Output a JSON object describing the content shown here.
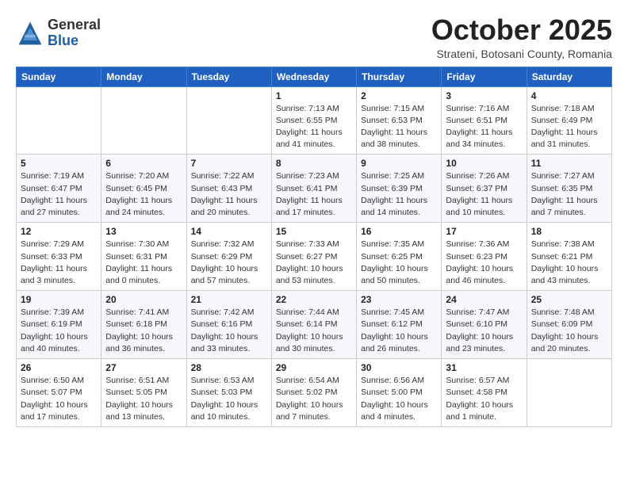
{
  "logo": {
    "general": "General",
    "blue": "Blue"
  },
  "header": {
    "month": "October 2025",
    "location": "Strateni, Botosani County, Romania"
  },
  "days_of_week": [
    "Sunday",
    "Monday",
    "Tuesday",
    "Wednesday",
    "Thursday",
    "Friday",
    "Saturday"
  ],
  "weeks": [
    [
      {
        "day": "",
        "info": ""
      },
      {
        "day": "",
        "info": ""
      },
      {
        "day": "",
        "info": ""
      },
      {
        "day": "1",
        "info": "Sunrise: 7:13 AM\nSunset: 6:55 PM\nDaylight: 11 hours\nand 41 minutes."
      },
      {
        "day": "2",
        "info": "Sunrise: 7:15 AM\nSunset: 6:53 PM\nDaylight: 11 hours\nand 38 minutes."
      },
      {
        "day": "3",
        "info": "Sunrise: 7:16 AM\nSunset: 6:51 PM\nDaylight: 11 hours\nand 34 minutes."
      },
      {
        "day": "4",
        "info": "Sunrise: 7:18 AM\nSunset: 6:49 PM\nDaylight: 11 hours\nand 31 minutes."
      }
    ],
    [
      {
        "day": "5",
        "info": "Sunrise: 7:19 AM\nSunset: 6:47 PM\nDaylight: 11 hours\nand 27 minutes."
      },
      {
        "day": "6",
        "info": "Sunrise: 7:20 AM\nSunset: 6:45 PM\nDaylight: 11 hours\nand 24 minutes."
      },
      {
        "day": "7",
        "info": "Sunrise: 7:22 AM\nSunset: 6:43 PM\nDaylight: 11 hours\nand 20 minutes."
      },
      {
        "day": "8",
        "info": "Sunrise: 7:23 AM\nSunset: 6:41 PM\nDaylight: 11 hours\nand 17 minutes."
      },
      {
        "day": "9",
        "info": "Sunrise: 7:25 AM\nSunset: 6:39 PM\nDaylight: 11 hours\nand 14 minutes."
      },
      {
        "day": "10",
        "info": "Sunrise: 7:26 AM\nSunset: 6:37 PM\nDaylight: 11 hours\nand 10 minutes."
      },
      {
        "day": "11",
        "info": "Sunrise: 7:27 AM\nSunset: 6:35 PM\nDaylight: 11 hours\nand 7 minutes."
      }
    ],
    [
      {
        "day": "12",
        "info": "Sunrise: 7:29 AM\nSunset: 6:33 PM\nDaylight: 11 hours\nand 3 minutes."
      },
      {
        "day": "13",
        "info": "Sunrise: 7:30 AM\nSunset: 6:31 PM\nDaylight: 11 hours\nand 0 minutes."
      },
      {
        "day": "14",
        "info": "Sunrise: 7:32 AM\nSunset: 6:29 PM\nDaylight: 10 hours\nand 57 minutes."
      },
      {
        "day": "15",
        "info": "Sunrise: 7:33 AM\nSunset: 6:27 PM\nDaylight: 10 hours\nand 53 minutes."
      },
      {
        "day": "16",
        "info": "Sunrise: 7:35 AM\nSunset: 6:25 PM\nDaylight: 10 hours\nand 50 minutes."
      },
      {
        "day": "17",
        "info": "Sunrise: 7:36 AM\nSunset: 6:23 PM\nDaylight: 10 hours\nand 46 minutes."
      },
      {
        "day": "18",
        "info": "Sunrise: 7:38 AM\nSunset: 6:21 PM\nDaylight: 10 hours\nand 43 minutes."
      }
    ],
    [
      {
        "day": "19",
        "info": "Sunrise: 7:39 AM\nSunset: 6:19 PM\nDaylight: 10 hours\nand 40 minutes."
      },
      {
        "day": "20",
        "info": "Sunrise: 7:41 AM\nSunset: 6:18 PM\nDaylight: 10 hours\nand 36 minutes."
      },
      {
        "day": "21",
        "info": "Sunrise: 7:42 AM\nSunset: 6:16 PM\nDaylight: 10 hours\nand 33 minutes."
      },
      {
        "day": "22",
        "info": "Sunrise: 7:44 AM\nSunset: 6:14 PM\nDaylight: 10 hours\nand 30 minutes."
      },
      {
        "day": "23",
        "info": "Sunrise: 7:45 AM\nSunset: 6:12 PM\nDaylight: 10 hours\nand 26 minutes."
      },
      {
        "day": "24",
        "info": "Sunrise: 7:47 AM\nSunset: 6:10 PM\nDaylight: 10 hours\nand 23 minutes."
      },
      {
        "day": "25",
        "info": "Sunrise: 7:48 AM\nSunset: 6:09 PM\nDaylight: 10 hours\nand 20 minutes."
      }
    ],
    [
      {
        "day": "26",
        "info": "Sunrise: 6:50 AM\nSunset: 5:07 PM\nDaylight: 10 hours\nand 17 minutes."
      },
      {
        "day": "27",
        "info": "Sunrise: 6:51 AM\nSunset: 5:05 PM\nDaylight: 10 hours\nand 13 minutes."
      },
      {
        "day": "28",
        "info": "Sunrise: 6:53 AM\nSunset: 5:03 PM\nDaylight: 10 hours\nand 10 minutes."
      },
      {
        "day": "29",
        "info": "Sunrise: 6:54 AM\nSunset: 5:02 PM\nDaylight: 10 hours\nand 7 minutes."
      },
      {
        "day": "30",
        "info": "Sunrise: 6:56 AM\nSunset: 5:00 PM\nDaylight: 10 hours\nand 4 minutes."
      },
      {
        "day": "31",
        "info": "Sunrise: 6:57 AM\nSunset: 4:58 PM\nDaylight: 10 hours\nand 1 minute."
      },
      {
        "day": "",
        "info": ""
      }
    ]
  ]
}
